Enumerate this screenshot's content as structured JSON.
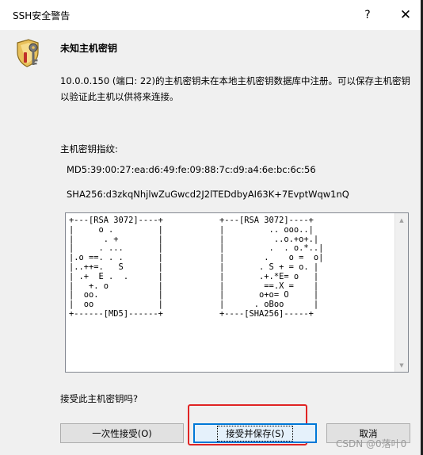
{
  "window": {
    "title": "SSH安全警告",
    "help_glyph": "?",
    "close_glyph": "✕"
  },
  "alert": {
    "icon": "security-shield-key-icon",
    "heading": "未知主机密钥",
    "message": "10.0.0.150 (端口: 22)的主机密钥未在本地主机密钥数据库中注册。可以保存主机密钥以验证此主机以供将来连接。"
  },
  "fingerprint": {
    "label": "主机密钥指纹:",
    "md5": "MD5:39:00:27:ea:d6:49:fe:09:88:7c:d9:a4:6e:bc:6c:56",
    "sha256": "SHA256:d3zkqNhjlwZuGwcd2J2lTEDdbyAI63K+7EvptWqw1nQ"
  },
  "randomart": {
    "md5": "+---[RSA 3072]----+\n|     o .         |\n|      . +        |\n|     . ...       |\n|.o ==. . .       |\n|..++=.   S       |\n| .+  E .  .      |\n|   +. o          |\n|  oo.            |\n|  oo             |\n+------[MD5]------+",
    "sha256": "+---[RSA 3072]----+\n|         .. ooo..|\n|          ..o.+o+.|\n|         .  . o.*..|\n|        .    o =  o|\n|       . S + = o. |\n|       .+.*E= o   |\n|        ==.X =    |\n|       o+o= O     |\n|      . oBoo      |\n+----[SHA256]-----+"
  },
  "question": "接受此主机密钥吗?",
  "buttons": {
    "accept_once": "一次性接受(O)",
    "accept_save": "接受并保存(S)",
    "cancel": "取消"
  },
  "colors": {
    "focus_border": "#0078d7",
    "annotation_red": "#e02424",
    "dialog_bg": "#f0f0f0"
  },
  "watermark": "CSDN @0落叶0"
}
